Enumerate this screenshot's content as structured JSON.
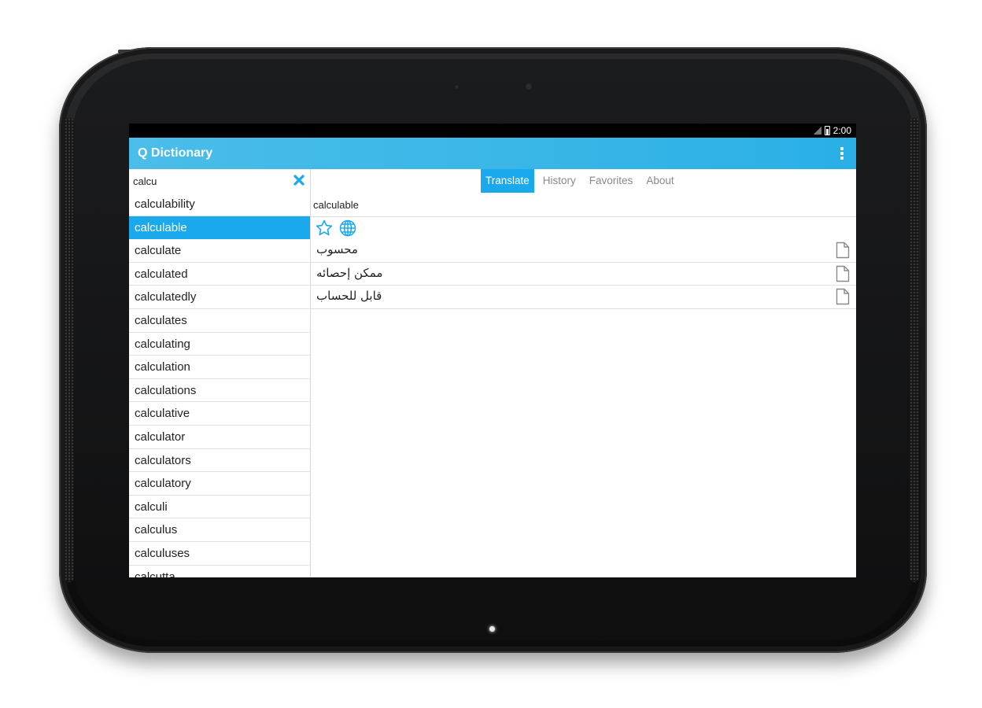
{
  "status_bar": {
    "time": "2:00"
  },
  "action_bar": {
    "title": "Q Dictionary"
  },
  "search": {
    "value": "calcu"
  },
  "word_list": [
    {
      "label": "calculability",
      "selected": false
    },
    {
      "label": "calculable",
      "selected": true
    },
    {
      "label": "calculate",
      "selected": false
    },
    {
      "label": "calculated",
      "selected": false
    },
    {
      "label": "calculatedly",
      "selected": false
    },
    {
      "label": "calculates",
      "selected": false
    },
    {
      "label": "calculating",
      "selected": false
    },
    {
      "label": "calculation",
      "selected": false
    },
    {
      "label": "calculations",
      "selected": false
    },
    {
      "label": "calculative",
      "selected": false
    },
    {
      "label": "calculator",
      "selected": false
    },
    {
      "label": "calculators",
      "selected": false
    },
    {
      "label": "calculatory",
      "selected": false
    },
    {
      "label": "calculi",
      "selected": false
    },
    {
      "label": "calculus",
      "selected": false
    },
    {
      "label": "calculuses",
      "selected": false
    },
    {
      "label": "calcutta",
      "selected": false
    }
  ],
  "tabs": [
    {
      "label": "Translate",
      "active": true
    },
    {
      "label": "History",
      "active": false
    },
    {
      "label": "Favorites",
      "active": false
    },
    {
      "label": "About",
      "active": false
    }
  ],
  "detail": {
    "term": "calculable",
    "translations": [
      "محسوب",
      "ممكن إحصائه",
      "قابل للحساب"
    ]
  },
  "colors": {
    "accent": "#1aa9ec",
    "action_bar": "#33b5e5",
    "icon_gray": "#8a8a8a"
  }
}
